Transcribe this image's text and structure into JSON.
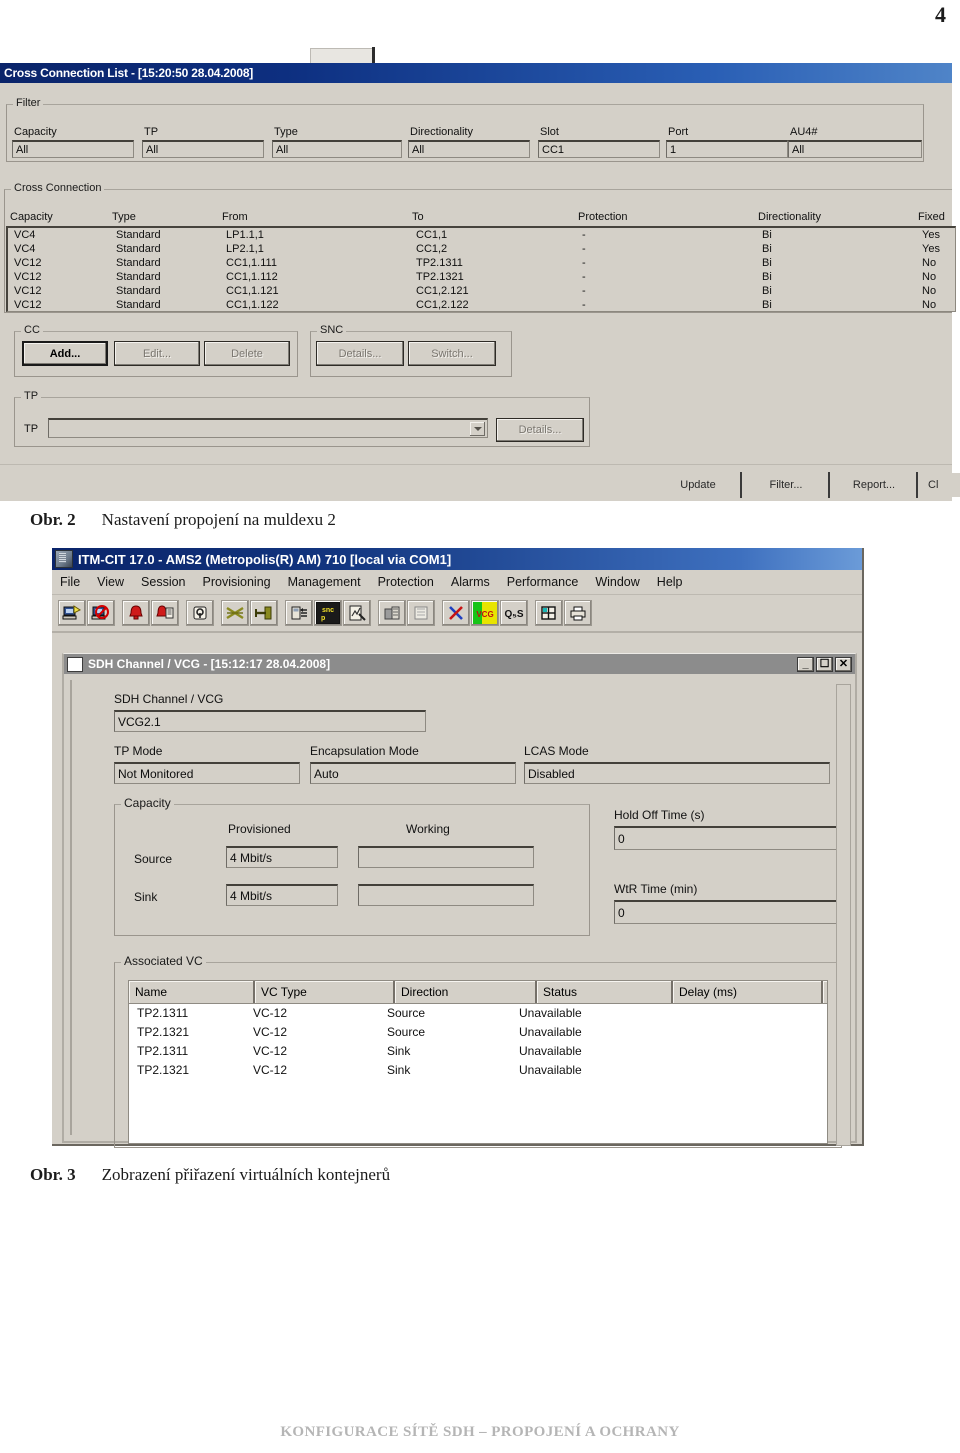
{
  "page": {
    "number": "4"
  },
  "figure1": {
    "titlebar": "Cross Connection List - [15:20:50 28.04.2008]",
    "filter": {
      "group_label": "Filter",
      "fields": [
        {
          "label": "Capacity",
          "value": "All"
        },
        {
          "label": "TP",
          "value": "All"
        },
        {
          "label": "Type",
          "value": "All"
        },
        {
          "label": "Directionality",
          "value": "All"
        },
        {
          "label": "Slot",
          "value": "CC1"
        },
        {
          "label": "Port",
          "value": "1"
        },
        {
          "label": "AU4#",
          "value": "All"
        }
      ]
    },
    "cross_connection": {
      "group_label": "Cross Connection",
      "columns": [
        "Capacity",
        "Type",
        "From",
        "To",
        "Protection",
        "Directionality",
        "Fixed"
      ],
      "rows": [
        [
          "VC4",
          "Standard",
          "LP1.1,1",
          "CC1,1",
          "-",
          "Bi",
          "Yes"
        ],
        [
          "VC4",
          "Standard",
          "LP2.1,1",
          "CC1,2",
          "-",
          "Bi",
          "Yes"
        ],
        [
          "VC12",
          "Standard",
          "CC1,1.111",
          "TP2.1311",
          "-",
          "Bi",
          "No"
        ],
        [
          "VC12",
          "Standard",
          "CC1,1.112",
          "TP2.1321",
          "-",
          "Bi",
          "No"
        ],
        [
          "VC12",
          "Standard",
          "CC1,1.121",
          "CC1,2.121",
          "-",
          "Bi",
          "No"
        ],
        [
          "VC12",
          "Standard",
          "CC1,1.122",
          "CC1,2.122",
          "-",
          "Bi",
          "No"
        ]
      ]
    },
    "cc_group": {
      "label": "CC",
      "buttons": [
        {
          "label": "Add...",
          "state": "default"
        },
        {
          "label": "Edit...",
          "state": "disabled"
        },
        {
          "label": "Delete",
          "state": "disabled"
        }
      ]
    },
    "snc_group": {
      "label": "SNC",
      "buttons": [
        {
          "label": "Details...",
          "state": "disabled"
        },
        {
          "label": "Switch...",
          "state": "disabled"
        }
      ]
    },
    "tp_group": {
      "label": "TP",
      "field_label": "TP",
      "value": "",
      "details_button": "Details..."
    },
    "bottom_buttons": [
      {
        "label": "Update"
      },
      {
        "label": "Filter..."
      },
      {
        "label": "Report..."
      },
      {
        "label": "Cl"
      }
    ]
  },
  "caption1": {
    "number": "Obr. 2",
    "text": "Nastavení propojení na muldexu 2"
  },
  "figure2": {
    "app_title": "ITM-CIT 17.0 - AMS2 (Metropolis(R) AM) 710 [local via COM1]",
    "menu": [
      "File",
      "View",
      "Session",
      "Provisioning",
      "Management",
      "Protection",
      "Alarms",
      "Performance",
      "Window",
      "Help"
    ],
    "toolbar_icons": [
      "workstation-icon",
      "no-workstation-icon",
      "alarm-bell-icon",
      "alarm-log-icon",
      "security-lock-icon",
      "cross-connect-icon",
      "terminate-icon",
      "equipment-icon",
      "snc-p-icon",
      "performance-icon",
      "rack-front-icon",
      "rack-back-icon",
      "delete-x-icon",
      "vcg-icon",
      "qos-icon",
      "grid-icon",
      "print-icon"
    ],
    "mdi": {
      "title": "SDH Channel / VCG - [15:12:17 28.04.2008]",
      "window_buttons": [
        "minimize",
        "maximize",
        "close"
      ],
      "channel_label": "SDH Channel / VCG",
      "channel_value": "VCG2.1",
      "modes": [
        {
          "label": "TP Mode",
          "value": "Not Monitored"
        },
        {
          "label": "Encapsulation Mode",
          "value": "Auto"
        },
        {
          "label": "LCAS Mode",
          "value": "Disabled"
        }
      ],
      "capacity": {
        "group_label": "Capacity",
        "col_provisioned": "Provisioned",
        "col_working": "Working",
        "rows": [
          {
            "label": "Source",
            "provisioned": "4 Mbit/s",
            "working": ""
          },
          {
            "label": "Sink",
            "provisioned": "4 Mbit/s",
            "working": ""
          }
        ]
      },
      "timers": [
        {
          "label": "Hold Off Time (s)",
          "value": "0"
        },
        {
          "label": "WtR Time (min)",
          "value": "0"
        }
      ],
      "associated_vc": {
        "group_label": "Associated VC",
        "columns": [
          "Name",
          "VC Type",
          "Direction",
          "Status",
          "Delay (ms)",
          ""
        ],
        "rows": [
          [
            "TP2.1311",
            "VC-12",
            "Source",
            "Unavailable",
            "",
            ""
          ],
          [
            "TP2.1321",
            "VC-12",
            "Source",
            "Unavailable",
            "",
            ""
          ],
          [
            "TP2.1311",
            "VC-12",
            "Sink",
            "Unavailable",
            "",
            ""
          ],
          [
            "TP2.1321",
            "VC-12",
            "Sink",
            "Unavailable",
            "",
            ""
          ]
        ]
      }
    }
  },
  "caption2": {
    "number": "Obr. 3",
    "text": "Zobrazení přiřazení virtuálních kontejnerů"
  },
  "footer": {
    "text": "KONFIGURACE SÍTĚ SDH – PROPOJENÍ A OCHRANY"
  },
  "colors": {
    "titlebar_start": "#0a246a",
    "titlebar_end": "#4f84c8",
    "window_face": "#d4d0c8",
    "mdi_title": "#8c8c8c",
    "footer_text": "#b5b5b5"
  }
}
